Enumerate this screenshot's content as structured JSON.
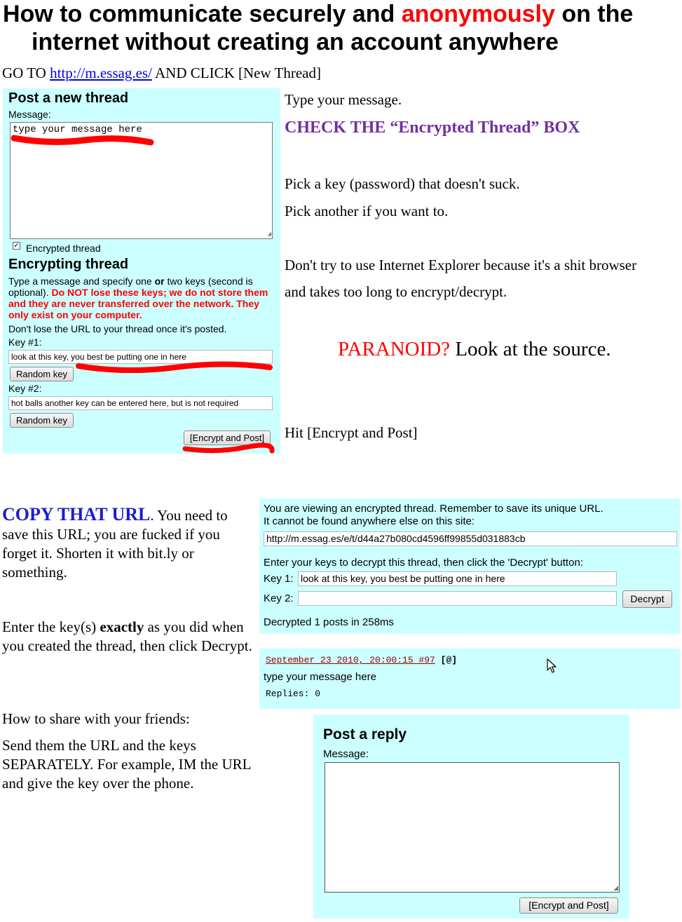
{
  "heading": {
    "part1": "How to communicate securely and ",
    "part_red": "anonymously",
    "part2": " on the",
    "line2": "internet without creating an account anywhere"
  },
  "intro": {
    "go_to": "GO TO",
    "link": "http://m.essag.es/",
    "and_click": "AND CLICK [New Thread]"
  },
  "new_thread_panel": {
    "title": "Post a new thread",
    "message_label": "Message:",
    "message_value": "type your message here",
    "encrypted_checkbox_label": "Encrypted thread",
    "encrypted_checked": true,
    "encrypting_title": "Encrypting thread",
    "desc_a": "Type a message and specify one ",
    "desc_or": "or",
    "desc_b": " two keys (second is optional).",
    "warning": "Do NOT lose these keys; we do not store them and they are never transferred over the network. They only exist on your computer.",
    "url_note": "Don't lose the URL to your thread once it's posted.",
    "key1_label": "Key #1:",
    "key1_value": "look at this key, you best be putting one in here",
    "random_key_button": "Random key",
    "key2_label": "Key #2:",
    "key2_value": "hot balls another key can be entered here, but is not required",
    "random_key_button_2": "Random key",
    "encrypt_post_button": "[Encrypt and Post]"
  },
  "right_notes": {
    "type_message": "Type your message.",
    "check_box": "CHECK THE “Encrypted Thread” BOX",
    "pick_key": "Pick a key (password) that doesn't suck.",
    "pick_another": "Pick another if you want to.",
    "ie_warning_1": "Don't try to use Internet Explorer because it's a shit browser",
    "ie_warning_2": "and takes too long to encrypt/decrypt.",
    "paranoid": "PARANOID?",
    "look_source": " Look at the source.",
    "hit_encrypt": "Hit [Encrypt and Post]"
  },
  "left_notes": {
    "copy_url": "COPY THAT URL",
    "copy_url_rest": ". You need to save this URL; you are fucked if you forget it. Shorten it with bit.ly or something.",
    "enter_keys_a": "Enter the key(s) ",
    "enter_keys_bold": "exactly",
    "enter_keys_b": " as you did when you created the thread, then click Decrypt.",
    "share_title": "How to share with your friends:",
    "share_body": "Send them the URL and the keys SEPARATELY. For example, IM the URL and give the key over the phone."
  },
  "decrypt_panel": {
    "notice_1": "You are viewing an encrypted thread. Remember to save its unique URL.",
    "notice_2": "It cannot be found anywhere else on this site:",
    "url_value": "http://m.essag.es/e/t/d44a27b080cd4596ff99855d031883cb",
    "enter_keys": "Enter your keys to decrypt this thread, then click the 'Decrypt' button:",
    "key1_label": "Key 1:",
    "key1_value": "look at this key, you best be putting one in here",
    "key2_label": "Key 2:",
    "key2_value": "",
    "decrypt_button": "Decrypt",
    "status": "Decrypted 1 posts in 258ms"
  },
  "post": {
    "meta_link": "September 23 2010, 20:00:15 #97",
    "at_link": "[@]",
    "body": "type your message here",
    "replies": "Replies: 0"
  },
  "reply_panel": {
    "title": "Post a reply",
    "message_label": "Message:",
    "message_value": "",
    "encrypt_post_button": "[Encrypt and Post]"
  },
  "colors": {
    "panel_bg": "#ccffff",
    "scribble_red": "#ff0000",
    "link_blue": "#0000ee",
    "purple": "#7030a0",
    "blue_heading": "#1c1ccf",
    "post_link_red": "#990000"
  }
}
